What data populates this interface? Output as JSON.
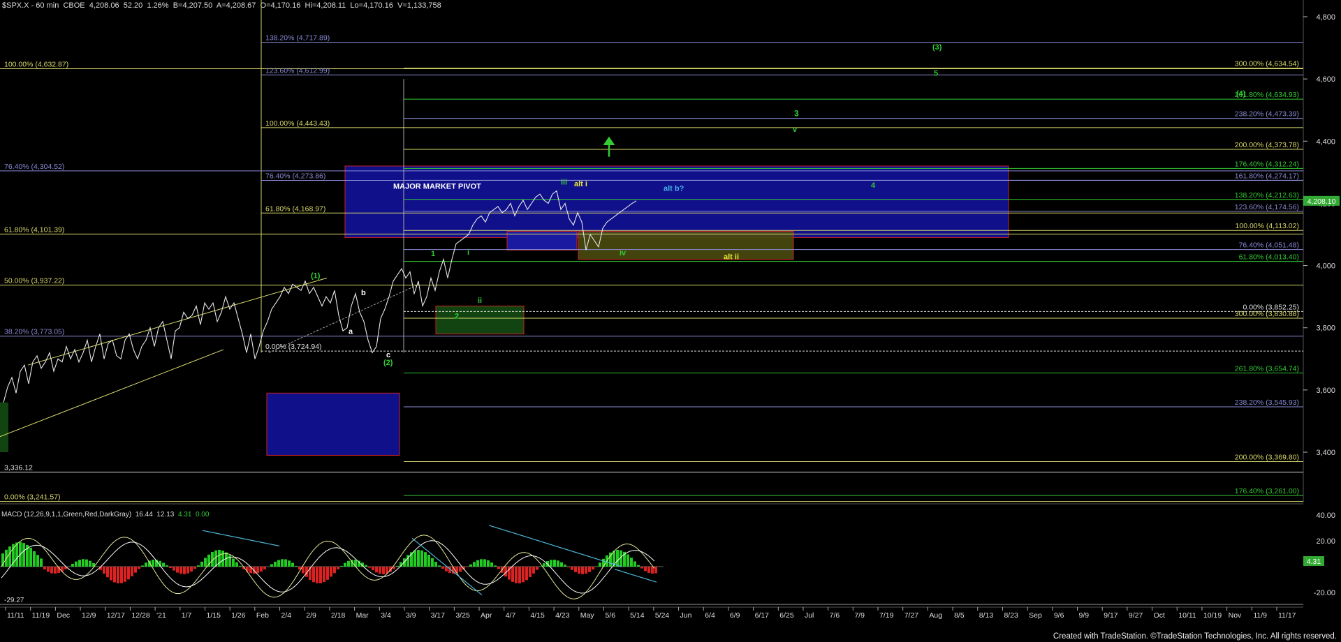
{
  "header": {
    "symbol": "$SPX.X - 60 min",
    "exchange": "CBOE",
    "last": "4,208.06",
    "change": "52.20",
    "change_pct": "1.26%",
    "bid": "B=4,207.50",
    "ask": "A=4,208.67",
    "open": "O=4,170.16",
    "high": "Hi=4,208.11",
    "low": "Lo=4,170.16",
    "volume": "V=1,133,758"
  },
  "footer": {
    "credit": "Created with TradeStation. ©TradeStation Technologies, Inc. All rights reserved."
  },
  "macd": {
    "label": "MACD (12,26,9,1,1,Green,Red,DarkGray)",
    "v1": "16.44",
    "v2": "12.13",
    "v3": "4.31",
    "v4": "0.00",
    "axis_ticks": [
      40,
      20,
      -20
    ],
    "last_value": "4.31",
    "min_label": "-29.27"
  },
  "colors": {
    "background": "#000000",
    "price": "#e8e8e8",
    "yellow_line": "#d9d96b",
    "blue_line": "#8a8ad8",
    "green_label": "#33cc33",
    "cyan_label": "#46b4e6",
    "pivot_fill": "#10108a",
    "red_border": "#cc2222",
    "last_price_box": "#33aa33",
    "macd_pos": "#22cc22",
    "macd_neg": "#dd2222",
    "trend_cyan": "#4fb8d8"
  },
  "chart_data": {
    "type": "line",
    "title": "$SPX.X - 60 min",
    "ylim": [
      3240,
      4930
    ],
    "y_ticks": [
      3400,
      3600,
      3800,
      4000,
      4200,
      4400,
      4600,
      4800
    ],
    "last_price": "4,208.10",
    "x_ticks": [
      "11/11",
      "11/19",
      "Dec",
      "12/9",
      "12/17",
      "12/28",
      "'21",
      "1/7",
      "1/15",
      "1/26",
      "Feb",
      "2/4",
      "2/9",
      "2/18",
      "Mar",
      "3/4",
      "3/9",
      "3/17",
      "3/25",
      "Apr",
      "4/7",
      "4/15",
      "4/23",
      "May",
      "5/6",
      "5/14",
      "5/24",
      "Jun",
      "6/4",
      "6/9",
      "6/17",
      "6/25",
      "Jul",
      "7/6",
      "7/9",
      "7/19",
      "7/27",
      "Aug",
      "8/5",
      "8/13",
      "8/23",
      "Sep",
      "9/6",
      "9/9",
      "9/17",
      "9/27",
      "Oct",
      "10/11",
      "10/19",
      "Nov",
      "11/9",
      "11/17"
    ],
    "price_path_x": [
      0,
      5,
      10,
      15,
      20,
      25,
      30,
      35,
      40,
      45,
      50,
      55,
      60,
      65,
      70,
      75,
      80,
      85,
      90,
      95,
      100,
      105,
      110,
      115,
      120,
      125,
      130,
      135,
      140,
      145,
      150,
      155,
      160,
      165,
      170,
      175,
      180,
      185,
      190,
      195,
      200,
      205,
      210,
      215,
      220,
      225,
      230,
      235,
      240,
      245,
      250,
      255,
      260,
      265,
      270,
      275,
      280,
      285,
      290,
      295,
      300,
      305,
      310,
      315,
      320,
      325,
      330,
      335,
      340,
      345,
      350,
      355,
      360,
      365,
      370,
      375,
      380,
      385,
      390,
      395,
      400,
      405,
      410,
      415,
      420,
      425,
      430,
      435,
      440,
      445,
      450,
      455,
      460,
      465,
      470,
      475,
      480,
      485,
      490,
      495,
      500,
      505,
      510,
      515,
      520,
      525,
      530,
      535,
      540,
      545,
      550,
      555,
      560,
      565,
      570,
      575,
      580,
      585,
      590,
      595,
      600,
      605,
      610,
      615,
      620,
      625,
      630,
      635,
      640,
      645,
      650,
      655,
      660,
      665,
      670,
      675,
      680,
      685,
      690,
      695,
      700,
      705,
      710,
      715,
      720,
      725,
      730,
      735,
      740,
      745,
      750,
      755,
      760,
      765,
      770,
      775
    ],
    "price_path_y": [
      3560,
      3610,
      3640,
      3590,
      3660,
      3680,
      3620,
      3690,
      3710,
      3670,
      3690,
      3720,
      3660,
      3700,
      3690,
      3740,
      3700,
      3730,
      3690,
      3720,
      3760,
      3690,
      3740,
      3780,
      3700,
      3750,
      3760,
      3710,
      3700,
      3760,
      3780,
      3730,
      3700,
      3740,
      3760,
      3800,
      3740,
      3800,
      3820,
      3760,
      3700,
      3790,
      3800,
      3850,
      3830,
      3840,
      3870,
      3810,
      3880,
      3860,
      3880,
      3820,
      3850,
      3900,
      3860,
      3880,
      3830,
      3780,
      3720,
      3780,
      3700,
      3740,
      3790,
      3820,
      3860,
      3880,
      3900,
      3930,
      3910,
      3940,
      3930,
      3920,
      3950,
      3910,
      3930,
      3900,
      3870,
      3900,
      3880,
      3920,
      3840,
      3790,
      3800,
      3870,
      3910,
      3850,
      3820,
      3760,
      3720,
      3740,
      3830,
      3860,
      3900,
      3950,
      3970,
      3990,
      3960,
      3980,
      3910,
      3950,
      3870,
      3900,
      3960,
      3920,
      3980,
      4020,
      3960,
      4020,
      4070,
      4080,
      4090,
      4100,
      4130,
      4150,
      4160,
      4140,
      4170,
      4180,
      4190,
      4170,
      4180,
      4200,
      4160,
      4190,
      4210,
      4180,
      4200,
      4220,
      4230,
      4210,
      4200,
      4230,
      4240,
      4180,
      4200,
      4150,
      4130,
      4170,
      4140,
      4050,
      4100,
      4080,
      4060,
      4120,
      4140,
      4150,
      4160,
      4170,
      4180,
      4190,
      4200,
      4208
    ],
    "horizontal_levels": [
      {
        "label": "100.00% (4,632.87)",
        "value": 4632.87,
        "color": "yellow",
        "side": "left"
      },
      {
        "label": "76.40% (4,304.52)",
        "value": 4304.52,
        "color": "blue",
        "side": "left"
      },
      {
        "label": "61.80% (4,101.39)",
        "value": 4101.39,
        "color": "yellow",
        "side": "left"
      },
      {
        "label": "50.00% (3,937.22)",
        "value": 3937.22,
        "color": "yellow",
        "side": "left"
      },
      {
        "label": "38.20% (3,773.05)",
        "value": 3773.05,
        "color": "blue",
        "side": "left"
      },
      {
        "label": "3,336.12",
        "value": 3336.12,
        "color": "white",
        "side": "left"
      },
      {
        "label": "0.00% (3,241.57)",
        "value": 3241.57,
        "color": "yellow",
        "side": "left"
      },
      {
        "label": "138.20% (4,717.89)",
        "value": 4717.89,
        "color": "blue",
        "side": "mid"
      },
      {
        "label": "123.60% (4,612.99)",
        "value": 4612.99,
        "color": "blue",
        "side": "mid"
      },
      {
        "label": "100.00% (4,443.43)",
        "value": 4443.43,
        "color": "yellow",
        "side": "mid"
      },
      {
        "label": "76.40% (4,273.86)",
        "value": 4273.86,
        "color": "blue",
        "side": "mid"
      },
      {
        "label": "61.80% (4,168.97)",
        "value": 4168.97,
        "color": "yellow",
        "side": "mid"
      },
      {
        "label": "0.00% (3,724.94)",
        "value": 3724.94,
        "color": "white",
        "side": "mid"
      },
      {
        "label": "300.00% (4,634.54)",
        "value": 4634.54,
        "color": "yellow",
        "side": "right"
      },
      {
        "label": "261.80% (4,634.93)",
        "value": 4534.93,
        "color": "green",
        "side": "right"
      },
      {
        "label": "238.20% (4,473.39)",
        "value": 4473.39,
        "color": "blue",
        "side": "right"
      },
      {
        "label": "200.00% (4,373.78)",
        "value": 4373.78,
        "color": "yellow",
        "side": "right"
      },
      {
        "label": "176.40% (4,312.24)",
        "value": 4312.24,
        "color": "green",
        "side": "right"
      },
      {
        "label": "161.80% (4,274.17)",
        "value": 4274.17,
        "color": "blue",
        "side": "right"
      },
      {
        "label": "138.20% (4,212.63)",
        "value": 4212.63,
        "color": "green",
        "side": "right"
      },
      {
        "label": "123.60% (4,174.56)",
        "value": 4174.56,
        "color": "blue",
        "side": "right"
      },
      {
        "label": "100.00% (4,113.02)",
        "value": 4113.02,
        "color": "yellow",
        "side": "right"
      },
      {
        "label": "76.40% (4,051.48)",
        "value": 4051.48,
        "color": "blue",
        "side": "right"
      },
      {
        "label": "61.80% (4,013.40)",
        "value": 4013.4,
        "color": "green",
        "side": "right"
      },
      {
        "label": "0.00% (3,852.25)",
        "value": 3852.25,
        "color": "white",
        "side": "right"
      },
      {
        "label": "300.00% (3,830.88)",
        "value": 3830.88,
        "color": "yellow",
        "side": "right"
      },
      {
        "label": "261.80% (3,654.74)",
        "value": 3654.74,
        "color": "green",
        "side": "right"
      },
      {
        "label": "238.20% (3,545.93)",
        "value": 3545.93,
        "color": "blue",
        "side": "right"
      },
      {
        "label": "200.00% (3,369.80)",
        "value": 3369.8,
        "color": "yellow",
        "side": "right"
      },
      {
        "label": "176.40% (3,261.00)",
        "value": 3261.0,
        "color": "green",
        "side": "right"
      }
    ],
    "annotations": [
      {
        "text": "MAJOR MARKET PIVOT",
        "color": "white"
      },
      {
        "text": "(1)",
        "color": "green"
      },
      {
        "text": "(2)",
        "color": "green"
      },
      {
        "text": "(3)",
        "color": "green"
      },
      {
        "text": "(4)",
        "color": "green"
      },
      {
        "text": "a",
        "color": "white"
      },
      {
        "text": "b",
        "color": "white"
      },
      {
        "text": "c",
        "color": "white"
      },
      {
        "text": "1",
        "color": "green"
      },
      {
        "text": "2",
        "color": "green"
      },
      {
        "text": "3",
        "color": "green"
      },
      {
        "text": "4",
        "color": "green"
      },
      {
        "text": "5",
        "color": "green"
      },
      {
        "text": "i",
        "color": "green"
      },
      {
        "text": "ii",
        "color": "green"
      },
      {
        "text": "iii",
        "color": "green"
      },
      {
        "text": "iv",
        "color": "green"
      },
      {
        "text": "v",
        "color": "green"
      },
      {
        "text": "alt i",
        "color": "yellow"
      },
      {
        "text": "alt ii",
        "color": "yellow"
      },
      {
        "text": "alt b?",
        "color": "cyan"
      }
    ]
  }
}
